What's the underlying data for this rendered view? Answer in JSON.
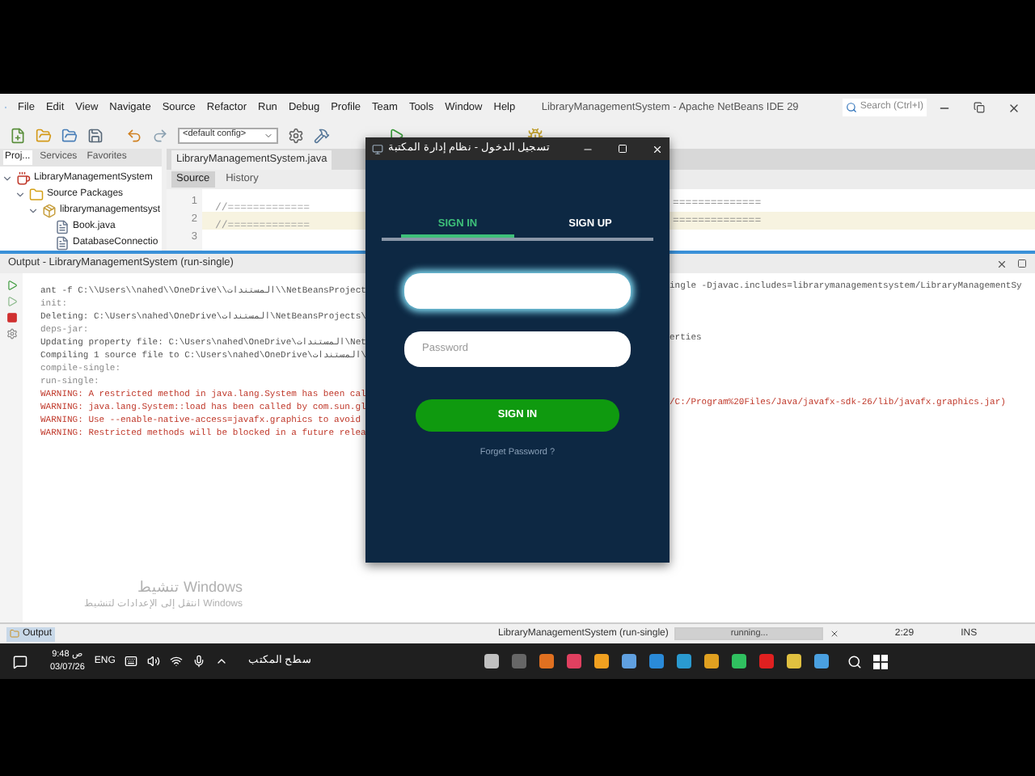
{
  "ide": {
    "title": "LibraryManagementSystem - Apache NetBeans IDE 29",
    "menu": [
      "File",
      "Edit",
      "View",
      "Navigate",
      "Source",
      "Refactor",
      "Run",
      "Debug",
      "Profile",
      "Team",
      "Tools",
      "Window",
      "Help"
    ],
    "search": {
      "placeholder": "Search (Ctrl+I)"
    },
    "config": "<default config>"
  },
  "projects": {
    "tabs": [
      {
        "label": "Proj...",
        "selected": true
      },
      {
        "label": "Services",
        "selected": false
      },
      {
        "label": "Favorites",
        "selected": false
      }
    ],
    "tree": [
      {
        "label": "LibraryManagementSystem",
        "kind": "project",
        "children": [
          {
            "label": "Source Packages",
            "kind": "folder",
            "children": [
              {
                "label": "librarymanagementsyst",
                "kind": "package",
                "children": [
                  {
                    "label": "Book.java",
                    "kind": "file"
                  },
                  {
                    "label": "DatabaseConnectio",
                    "kind": "file"
                  }
                ]
              }
            ]
          }
        ]
      }
    ]
  },
  "editor": {
    "tab": "LibraryManagementSystem.java",
    "modes": [
      {
        "label": "Source",
        "selected": true
      },
      {
        "label": "History",
        "selected": false
      }
    ],
    "lines": [
      {
        "number": "1",
        "text": "//=============",
        "tail": "==============",
        "current": false
      },
      {
        "number": "2",
        "text": "//=============",
        "tail": "==============",
        "current": true
      },
      {
        "number": "3",
        "current": false
      }
    ]
  },
  "output": {
    "title": "Output - LibraryManagementSystem (run-single)",
    "lines": [
      {
        "kind": "command",
        "text": "ant -f C:\\\\Users\\\\nahed\\\\OneDrive\\\\المستندات\\\\NetBeansProject",
        "tail": "ingle -Djavac.includes=librarymanagementsystem/LibraryManagementSy"
      },
      {
        "kind": "target",
        "text": "init:"
      },
      {
        "kind": "command",
        "text": "Deleting: C:\\Users\\nahed\\OneDrive\\المستندات\\NetBeansProjects\\"
      },
      {
        "kind": "target",
        "text": "deps-jar:"
      },
      {
        "kind": "command",
        "text": "Updating property file: C:\\Users\\nahed\\OneDrive\\المستندات\\Net",
        "tail": "erties"
      },
      {
        "kind": "command",
        "text": "Compiling 1 source file to C:\\Users\\nahed\\OneDrive\\المستندات\\"
      },
      {
        "kind": "target",
        "text": "compile-single:"
      },
      {
        "kind": "target",
        "text": "run-single:"
      },
      {
        "kind": "warning",
        "text": "WARNING: A restricted method in java.lang.System has been cal"
      },
      {
        "kind": "warning",
        "text": "WARNING: java.lang.System::load has been called by com.sun.gl",
        "tail": "/C:/Program%20Files/Java/javafx-sdk-26/lib/javafx.graphics.jar)"
      },
      {
        "kind": "warning",
        "text": "WARNING: Use --enable-native-access=javafx.graphics to avoid"
      },
      {
        "kind": "warning",
        "text": "WARNING: Restricted methods will be blocked in a future relea"
      }
    ]
  },
  "activation": {
    "title": "تنشيط Windows",
    "text": "انتقل إلى الإعدادات لتنشيط Windows"
  },
  "status_bar": {
    "tab": "Output",
    "task": "LibraryManagementSystem (run-single)",
    "progress": "running...",
    "level": 1,
    "position": "2:29",
    "mode": "INS"
  },
  "taskbar": {
    "time": "9:48 ص",
    "date": "03/07/26",
    "language": "ENG",
    "desktop": "سطح المكتب"
  },
  "dialog": {
    "title": "تسجيل الدخول - نظام إدارة المكتبة",
    "tabs": [
      {
        "label": "SIGN IN",
        "selected": true
      },
      {
        "label": "SIGN UP",
        "selected": false
      }
    ],
    "username": {
      "focused": true
    },
    "password": {
      "placeholder": "Password",
      "focused": false
    },
    "button": "SIGN IN",
    "link": "Forget Password ?"
  }
}
